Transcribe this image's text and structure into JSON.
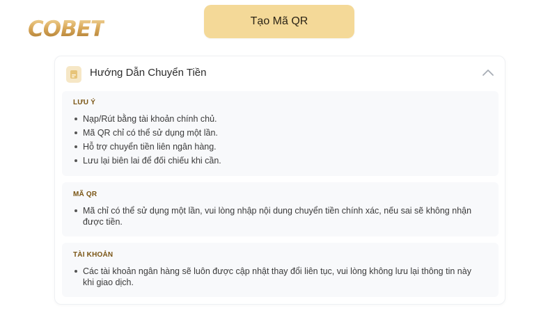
{
  "brand": {
    "logo_text": "COBET"
  },
  "actions": {
    "create_qr_label": "Tạo Mã QR"
  },
  "panel": {
    "title": "Hướng Dẫn Chuyển Tiền",
    "sections": [
      {
        "title": "LƯU Ý",
        "items": [
          "Nạp/Rút bằng tài khoản chính chủ.",
          "Mã QR chỉ có thể sử dụng một lần.",
          "Hỗ trợ chuyển tiền liên ngân hàng.",
          "Lưu lại biên lai để đối chiếu khi cần."
        ]
      },
      {
        "title": "MÃ QR",
        "items": [
          "Mã chỉ có thể sử dụng một lần, vui lòng nhập nội dung chuyển tiền chính xác, nếu sai sẽ không nhận được tiền."
        ]
      },
      {
        "title": "TÀI KHOẢN",
        "items": [
          "Các tài khoản ngân hàng sẽ luôn được cập nhật thay đổi liên tục, vui lòng không lưu lại thông tin này khi giao dịch."
        ]
      }
    ]
  },
  "colors": {
    "accent": "#f4d998",
    "section_title": "#7a5514",
    "section_bg": "#f8f9fb"
  },
  "icons": {
    "header_icon": "document-icon",
    "collapse_icon": "chevron-up-icon"
  }
}
